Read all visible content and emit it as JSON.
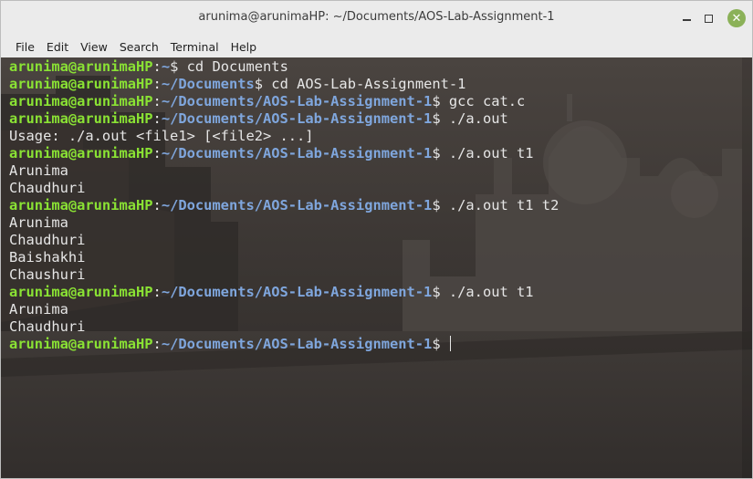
{
  "window": {
    "title": "arunima@arunimaHP: ~/Documents/AOS-Lab-Assignment-1"
  },
  "menu": {
    "items": [
      "File",
      "Edit",
      "View",
      "Search",
      "Terminal",
      "Help"
    ]
  },
  "colors": {
    "user": "#8ae234",
    "path": "#7fa6dd",
    "text": "#e6e6e6",
    "close": "#8bb158"
  },
  "terminal": {
    "lines": [
      {
        "type": "prompt",
        "user": "arunima@arunimaHP",
        "sep": ":",
        "path": "~",
        "sym": "$ ",
        "cmd": "cd Documents"
      },
      {
        "type": "prompt",
        "user": "arunima@arunimaHP",
        "sep": ":",
        "path": "~/Documents",
        "sym": "$ ",
        "cmd": "cd AOS-Lab-Assignment-1"
      },
      {
        "type": "prompt",
        "user": "arunima@arunimaHP",
        "sep": ":",
        "path": "~/Documents/AOS-Lab-Assignment-1",
        "sym": "$ ",
        "cmd": "gcc cat.c"
      },
      {
        "type": "prompt",
        "user": "arunima@arunimaHP",
        "sep": ":",
        "path": "~/Documents/AOS-Lab-Assignment-1",
        "sym": "$ ",
        "cmd": "./a.out"
      },
      {
        "type": "output",
        "text": "Usage: ./a.out <file1> [<file2> ...]"
      },
      {
        "type": "prompt",
        "user": "arunima@arunimaHP",
        "sep": ":",
        "path": "~/Documents/AOS-Lab-Assignment-1",
        "sym": "$ ",
        "cmd": "./a.out t1"
      },
      {
        "type": "output",
        "text": "Arunima"
      },
      {
        "type": "output",
        "text": "Chaudhuri"
      },
      {
        "type": "prompt",
        "user": "arunima@arunimaHP",
        "sep": ":",
        "path": "~/Documents/AOS-Lab-Assignment-1",
        "sym": "$ ",
        "cmd": "./a.out t1 t2"
      },
      {
        "type": "output",
        "text": "Arunima"
      },
      {
        "type": "output",
        "text": "Chaudhuri"
      },
      {
        "type": "output",
        "text": "Baishakhi"
      },
      {
        "type": "output",
        "text": "Chaushuri"
      },
      {
        "type": "prompt",
        "user": "arunima@arunimaHP",
        "sep": ":",
        "path": "~/Documents/AOS-Lab-Assignment-1",
        "sym": "$ ",
        "cmd": "./a.out t1"
      },
      {
        "type": "output",
        "text": "Arunima"
      },
      {
        "type": "output",
        "text": "Chaudhuri"
      },
      {
        "type": "prompt",
        "user": "arunima@arunimaHP",
        "sep": ":",
        "path": "~/Documents/AOS-Lab-Assignment-1",
        "sym": "$ ",
        "cmd": "",
        "cursor": true
      }
    ]
  }
}
